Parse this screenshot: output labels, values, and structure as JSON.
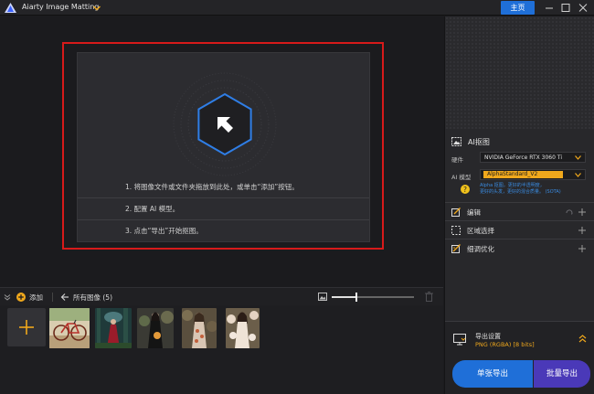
{
  "titlebar": {
    "app_title": "Aiarty Image Matting",
    "home_label": "主页"
  },
  "drop_zone": {
    "steps": [
      "1. 将图像文件或文件夹拖放到此处，或单击“添加”按钮。",
      "2. 配置 AI 模型。",
      "3. 点击“导出”开始抠图。"
    ]
  },
  "gallery_toolbar": {
    "add_label": "添加",
    "all_images_label": "所有图像 (5)",
    "zoom_level": 0.3
  },
  "gallery": {
    "images": [
      {
        "name": "bicycle"
      },
      {
        "name": "forest-woman"
      },
      {
        "name": "woman-black-dress"
      },
      {
        "name": "woman-floral"
      },
      {
        "name": "woman-flowers"
      }
    ]
  },
  "ai_panel": {
    "title": "AI抠图",
    "hardware_label": "硬件",
    "hardware_value": "NVIDIA GeForce RTX 3060 Ti",
    "model_label": "AI 模型",
    "model_value": "AlphaStandard_V2",
    "model_desc_line1": "Alpha 抠图，更好的半透明度，",
    "model_desc_line2": "更好的头发，更好的混合质量。 (SOTA)"
  },
  "sections": {
    "edit": "编辑",
    "region_select": "区域选择",
    "refine": "细调优化"
  },
  "export": {
    "title": "导出设置",
    "format": "PNG (RGBA) [8 bits]",
    "single_label": "单张导出",
    "batch_label": "批量导出"
  },
  "colors": {
    "accent_blue": "#1f6fd8",
    "accent_purple": "#4a39b8",
    "model_highlight": "#f0a81c",
    "drop_frame": "#d71a1a"
  }
}
